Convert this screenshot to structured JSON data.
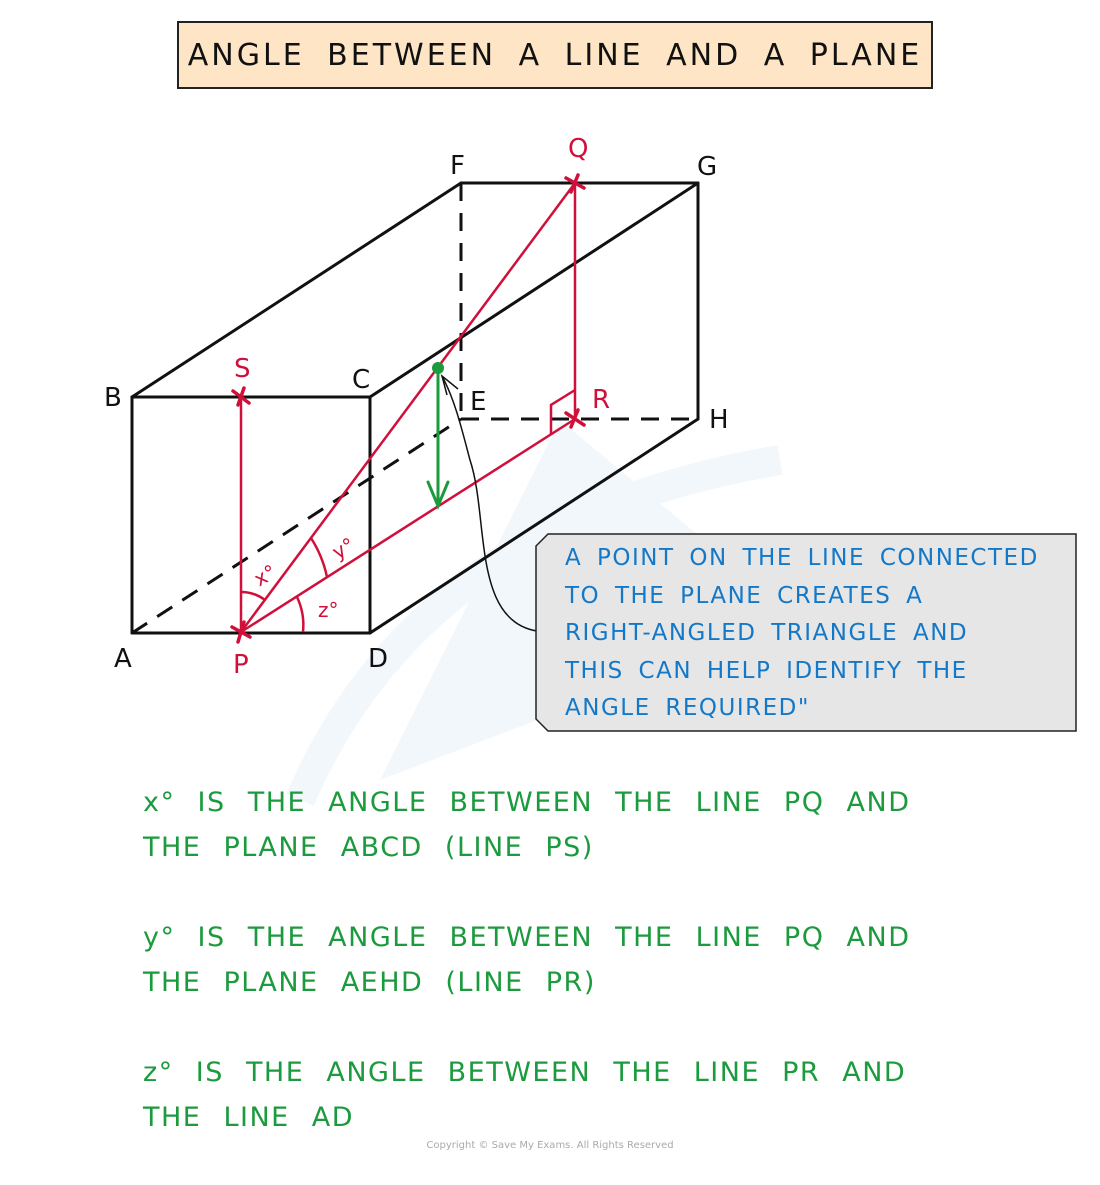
{
  "title": "ANGLE BETWEEN A LINE AND A PLANE",
  "colors": {
    "title_bg": "#fde5c6",
    "edge": "#111111",
    "construction": "#d0103a",
    "perpendicular": "#1c9a3e",
    "callout_text": "#1478c8",
    "callout_bg": "#e6e6e6",
    "notes_text": "#1c9a3e"
  },
  "vertices": {
    "A": "A",
    "B": "B",
    "C": "C",
    "D": "D",
    "E": "E",
    "F": "F",
    "G": "G",
    "H": "H"
  },
  "points": {
    "P": "P",
    "Q": "Q",
    "R": "R",
    "S": "S"
  },
  "angles": {
    "x": "x°",
    "y": "y°",
    "z": "z°"
  },
  "callout": {
    "lines": [
      "A POINT ON THE LINE CONNECTED",
      "TO THE PLANE CREATES A",
      "RIGHT-ANGLED TRIANGLE AND",
      "THIS CAN HELP IDENTIFY THE",
      "ANGLE REQUIRED\""
    ]
  },
  "notes": [
    {
      "line1": "x° IS THE ANGLE BETWEEN THE LINE PQ AND",
      "line2": "THE PLANE ABCD (LINE PS)"
    },
    {
      "line1": "y° IS THE ANGLE BETWEEN THE LINE PQ AND",
      "line2": "THE PLANE AEHD (LINE PR)"
    },
    {
      "line1": "z° IS THE ANGLE BETWEEN THE LINE PR AND",
      "line2": "THE LINE AD"
    }
  ],
  "copyright": "Copyright © Save My Exams. All Rights Reserved"
}
